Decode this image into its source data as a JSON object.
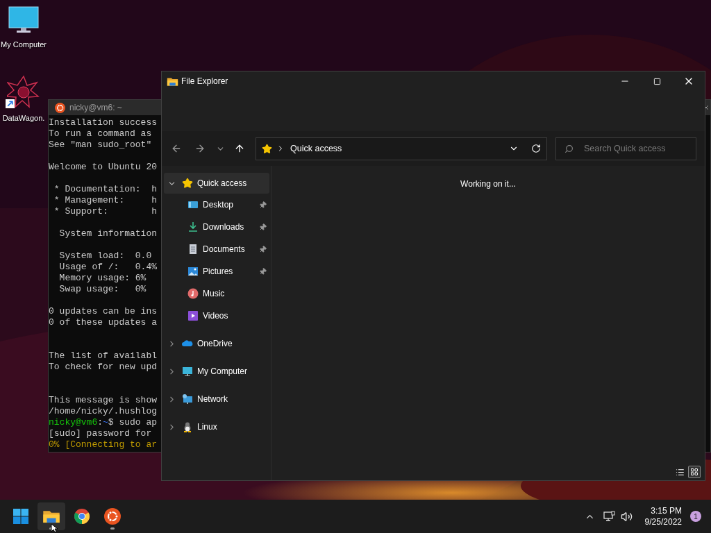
{
  "desktop": {
    "icons": [
      {
        "kind": "computer",
        "label": "My Computer",
        "shortcut": false
      },
      {
        "kind": "app",
        "label": "DataWagon.",
        "shortcut": true
      }
    ]
  },
  "terminal": {
    "title": "nicky@vm6: ~",
    "blocks": [
      {
        "lines": [
          {
            "kind": "output",
            "text": "Installation success"
          },
          {
            "kind": "output",
            "text": "To run a command as"
          },
          {
            "kind": "output",
            "text": "See \"man sudo_root\""
          }
        ]
      },
      {
        "lines": [
          {
            "kind": "output",
            "text": "Welcome to Ubuntu 20"
          }
        ]
      },
      {
        "lines": [
          {
            "kind": "output",
            "text": " * Documentation:  h"
          },
          {
            "kind": "output",
            "text": " * Management:     h"
          },
          {
            "kind": "output",
            "text": " * Support:        h"
          }
        ]
      },
      {
        "lines": [
          {
            "kind": "output",
            "text": "  System information"
          }
        ]
      },
      {
        "lines": [
          {
            "kind": "output",
            "text": "  System load:  0.0"
          },
          {
            "kind": "output",
            "text": "  Usage of /:   0.4%"
          },
          {
            "kind": "output",
            "text": "  Memory usage: 6%"
          },
          {
            "kind": "output",
            "text": "  Swap usage:   0%"
          }
        ]
      },
      {
        "lines": [
          {
            "kind": "output",
            "text": "0 updates can be ins"
          },
          {
            "kind": "output",
            "text": "0 of these updates a"
          }
        ]
      },
      {
        "lines": [
          {
            "kind": "output",
            "text": "The list of availabl"
          },
          {
            "kind": "output",
            "text": "To check for new upd"
          }
        ]
      },
      {
        "lines": [
          {
            "kind": "output",
            "text": "This message is show"
          },
          {
            "kind": "output",
            "text": "/home/nicky/.hushlog"
          },
          {
            "kind": "prompt",
            "user": "nicky@vm6",
            "separator": ":",
            "path": "~",
            "text": "$ sudo ap"
          },
          {
            "kind": "output",
            "text": "[sudo] password for"
          },
          {
            "kind": "progress",
            "text": "0% [Connecting to ar"
          }
        ]
      }
    ]
  },
  "explorer": {
    "title": "File Explorer",
    "address": {
      "location": "Quick access"
    },
    "search": {
      "placeholder": "Search Quick access"
    },
    "nav": [
      {
        "label": "Quick access",
        "kind": "star",
        "expanded": true,
        "selected": true,
        "children": [
          {
            "label": "Desktop",
            "kind": "desktop",
            "pinned": true,
            "selected": false
          },
          {
            "label": "Downloads",
            "kind": "download",
            "pinned": true,
            "selected": false
          },
          {
            "label": "Documents",
            "kind": "document",
            "pinned": true,
            "selected": false
          },
          {
            "label": "Pictures",
            "kind": "pictures",
            "pinned": true,
            "selected": false
          },
          {
            "label": "Music",
            "kind": "music",
            "pinned": false,
            "selected": false
          },
          {
            "label": "Videos",
            "kind": "videos",
            "pinned": false,
            "selected": false
          }
        ]
      },
      {
        "label": "OneDrive",
        "kind": "cloud",
        "expanded": false,
        "selected": false
      },
      {
        "label": "My Computer",
        "kind": "computer",
        "expanded": false,
        "selected": false
      },
      {
        "label": "Network",
        "kind": "network",
        "expanded": false,
        "selected": false
      },
      {
        "label": "Linux",
        "kind": "linux",
        "expanded": false,
        "selected": false
      }
    ],
    "status": "Working on it...",
    "views": [
      {
        "kind": "details",
        "selected": false
      },
      {
        "kind": "tiles",
        "selected": true
      }
    ]
  },
  "taskbar": {
    "apps": [
      {
        "kind": "start",
        "selected": false,
        "running": false
      },
      {
        "kind": "explorer",
        "selected": true,
        "running": true
      },
      {
        "kind": "browser",
        "selected": false,
        "running": false
      },
      {
        "kind": "ubuntu",
        "selected": false,
        "running": true
      }
    ],
    "time": "3:15 PM",
    "date": "9/25/2022",
    "notifications": "1"
  }
}
